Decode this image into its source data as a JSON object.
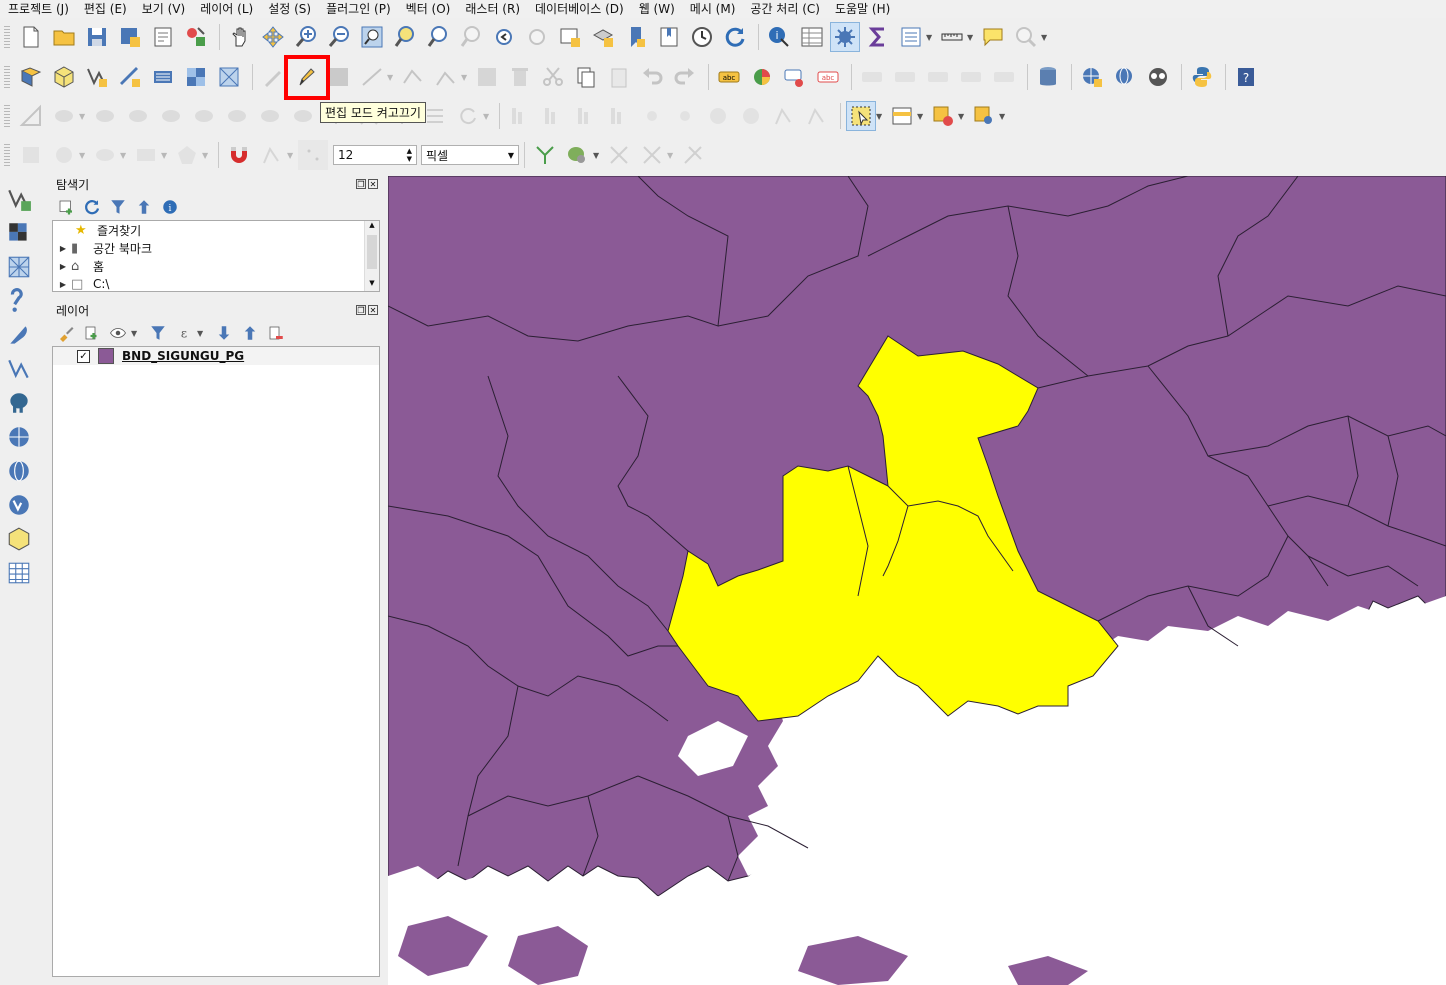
{
  "menu": [
    "프로젝트 (J)",
    "편집 (E)",
    "보기 (V)",
    "레이어 (L)",
    "설정 (S)",
    "플러그인 (P)",
    "벡터 (O)",
    "래스터 (R)",
    "데이터베이스 (D)",
    "웹 (W)",
    "메시 (M)",
    "공간 처리 (C)",
    "도움말 (H)"
  ],
  "tooltip": "편집 모드 켜고끄기",
  "snapping": {
    "tolerance": "12",
    "unit": "픽셀"
  },
  "browser": {
    "title": "탐색기",
    "items": [
      "즐겨찾기",
      "공간 북마크",
      "홈",
      "C:\\"
    ]
  },
  "layers": {
    "title": "레이어",
    "items": [
      {
        "name": "BND_SIGUNGU_PG",
        "checked": true,
        "color": "#8b5a96"
      }
    ]
  },
  "colors": {
    "region_fill": "#8b5a96",
    "selected_fill": "#ffff00",
    "highlight": "#ff0000"
  },
  "icons": {
    "toolbar1": [
      "new-project-icon",
      "open-project-icon",
      "save-project-icon",
      "save-as-icon",
      "print-layout-icon",
      "style-manager-icon",
      "pan-icon",
      "pan-to-selection-icon",
      "zoom-in-icon",
      "zoom-out-icon",
      "zoom-full-icon",
      "zoom-to-selection-icon",
      "zoom-to-layer-icon",
      "zoom-native-icon",
      "zoom-last-icon",
      "zoom-next-icon",
      "new-map-view-icon",
      "new-3d-view-icon",
      "bookmark-icon",
      "show-bookmarks-icon",
      "temporal-icon",
      "refresh-icon",
      "identify-icon",
      "attribute-table-icon",
      "statistics-icon",
      "sum-icon",
      "field-calculator-icon",
      "measure-icon",
      "annotation-icon",
      "search-icon"
    ],
    "toolbar2": [
      "data-source-manager-icon",
      "new-geopackage-icon",
      "new-shapefile-icon",
      "new-scratch-layer-icon",
      "new-virtual-icon",
      "add-raster-icon",
      "add-mesh-icon",
      "current-edits-icon",
      "toggle-editing-icon",
      "save-edits-icon",
      "digitize-icon",
      "vertex-tool-icon",
      "modify-attributes-icon",
      "delete-icon",
      "cut-icon",
      "copy-icon",
      "paste-icon",
      "undo-icon",
      "redo-icon",
      "label-icon",
      "diagram-icon",
      "highlight-pin-icon",
      "label-abc-icon",
      "pin-label-icon",
      "show-label-icon",
      "move-label-icon",
      "rotate-label-icon",
      "change-label-icon",
      "database-icon",
      "wms-icon",
      "wcs-icon",
      "xyz-icon",
      "python-icon",
      "help-icon"
    ]
  }
}
